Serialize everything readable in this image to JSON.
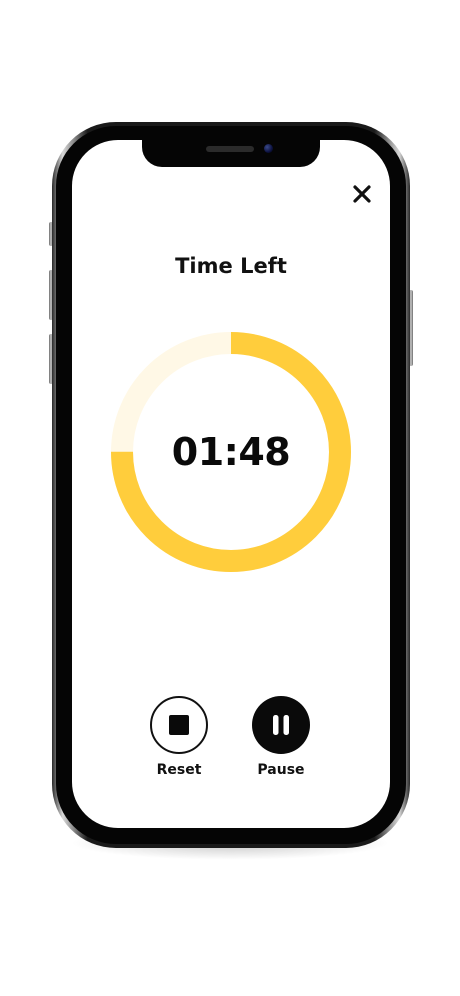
{
  "timer": {
    "title": "Time Left",
    "time_remaining": "01:48",
    "progress_fraction_remaining": 0.75
  },
  "controls": {
    "reset_label": "Reset",
    "pause_label": "Pause"
  },
  "icons": {
    "close": "close-icon",
    "reset": "stop-square-icon",
    "pause": "pause-icon"
  },
  "colors": {
    "accent": "#FFCD3C",
    "track": "#FFF8E6",
    "text": "#111111",
    "button_dark": "#0A0A0A"
  }
}
